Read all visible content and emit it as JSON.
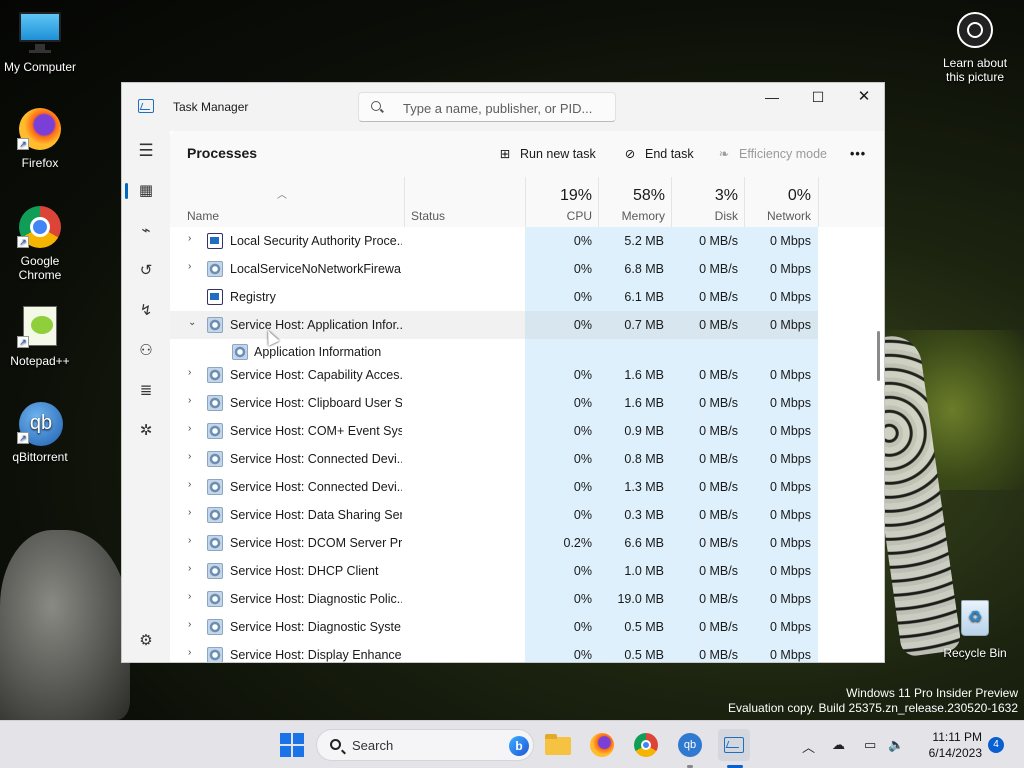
{
  "desktop": {
    "icons": [
      {
        "label": "My Computer"
      },
      {
        "label": "Firefox"
      },
      {
        "label": "Google Chrome"
      },
      {
        "label": "Notepad++"
      },
      {
        "label": "qBittorrent"
      }
    ],
    "learn_label": "Learn about this picture",
    "recycle_label": "Recycle Bin",
    "watermark_line1": "Windows 11 Pro Insider Preview",
    "watermark_line2": "Evaluation copy. Build 25375.zn_release.230520-1632"
  },
  "window": {
    "title": "Task Manager",
    "search_placeholder": "Type a name, publisher, or PID...",
    "minimize": "—",
    "maximize": "☐",
    "close": "✕"
  },
  "commandbar": {
    "page_title": "Processes",
    "run_new_task": "Run new task",
    "end_task": "End task",
    "efficiency_mode": "Efficiency mode",
    "more": "•••"
  },
  "table": {
    "headers": {
      "name": "Name",
      "status": "Status",
      "cpu_pct": "19%",
      "cpu": "CPU",
      "memory_pct": "58%",
      "memory": "Memory",
      "disk_pct": "3%",
      "disk": "Disk",
      "network_pct": "0%",
      "network": "Network"
    },
    "rows": [
      {
        "name": "Local Security Authority Proce...",
        "cpu": "0%",
        "mem": "5.2 MB",
        "disk": "0 MB/s",
        "net": "0 Mbps",
        "expand": "›",
        "icon": "box"
      },
      {
        "name": "LocalServiceNoNetworkFirewa...",
        "cpu": "0%",
        "mem": "6.8 MB",
        "disk": "0 MB/s",
        "net": "0 Mbps",
        "expand": "›",
        "icon": "gear"
      },
      {
        "name": "Registry",
        "cpu": "0%",
        "mem": "6.1 MB",
        "disk": "0 MB/s",
        "net": "0 Mbps",
        "expand": "",
        "icon": "box"
      },
      {
        "name": "Service Host: Application Infor...",
        "cpu": "0%",
        "mem": "0.7 MB",
        "disk": "0 MB/s",
        "net": "0 Mbps",
        "expand": "⌄",
        "icon": "gear",
        "selected": true
      },
      {
        "name": "Application Information",
        "child": true,
        "cpu": "",
        "mem": "",
        "disk": "",
        "net": "",
        "expand": "",
        "icon": "gear"
      },
      {
        "name": "Service Host: Capability Acces...",
        "cpu": "0%",
        "mem": "1.6 MB",
        "disk": "0 MB/s",
        "net": "0 Mbps",
        "expand": "›",
        "icon": "gear"
      },
      {
        "name": "Service Host: Clipboard User S...",
        "cpu": "0%",
        "mem": "1.6 MB",
        "disk": "0 MB/s",
        "net": "0 Mbps",
        "expand": "›",
        "icon": "gear"
      },
      {
        "name": "Service Host: COM+ Event Sys...",
        "cpu": "0%",
        "mem": "0.9 MB",
        "disk": "0 MB/s",
        "net": "0 Mbps",
        "expand": "›",
        "icon": "gear"
      },
      {
        "name": "Service Host: Connected Devi...",
        "cpu": "0%",
        "mem": "0.8 MB",
        "disk": "0 MB/s",
        "net": "0 Mbps",
        "expand": "›",
        "icon": "gear"
      },
      {
        "name": "Service Host: Connected Devi...",
        "cpu": "0%",
        "mem": "1.3 MB",
        "disk": "0 MB/s",
        "net": "0 Mbps",
        "expand": "›",
        "icon": "gear"
      },
      {
        "name": "Service Host: Data Sharing Ser...",
        "cpu": "0%",
        "mem": "0.3 MB",
        "disk": "0 MB/s",
        "net": "0 Mbps",
        "expand": "›",
        "icon": "gear"
      },
      {
        "name": "Service Host: DCOM Server Pr...",
        "cpu": "0.2%",
        "mem": "6.6 MB",
        "disk": "0 MB/s",
        "net": "0 Mbps",
        "expand": "›",
        "icon": "gear"
      },
      {
        "name": "Service Host: DHCP Client",
        "cpu": "0%",
        "mem": "1.0 MB",
        "disk": "0 MB/s",
        "net": "0 Mbps",
        "expand": "›",
        "icon": "gear"
      },
      {
        "name": "Service Host: Diagnostic Polic...",
        "cpu": "0%",
        "mem": "19.0 MB",
        "disk": "0 MB/s",
        "net": "0 Mbps",
        "expand": "›",
        "icon": "gear"
      },
      {
        "name": "Service Host: Diagnostic Syste...",
        "cpu": "0%",
        "mem": "0.5 MB",
        "disk": "0 MB/s",
        "net": "0 Mbps",
        "expand": "›",
        "icon": "gear"
      },
      {
        "name": "Service Host: Display Enhance...",
        "cpu": "0%",
        "mem": "0.5 MB",
        "disk": "0 MB/s",
        "net": "0 Mbps",
        "expand": "›",
        "icon": "gear"
      }
    ]
  },
  "taskbar": {
    "search_label": "Search",
    "time": "11:11 PM",
    "date": "6/14/2023",
    "notification_count": "4"
  },
  "colors": {
    "accent": "#0067c0",
    "cpu_column": "#ddf0fc"
  }
}
